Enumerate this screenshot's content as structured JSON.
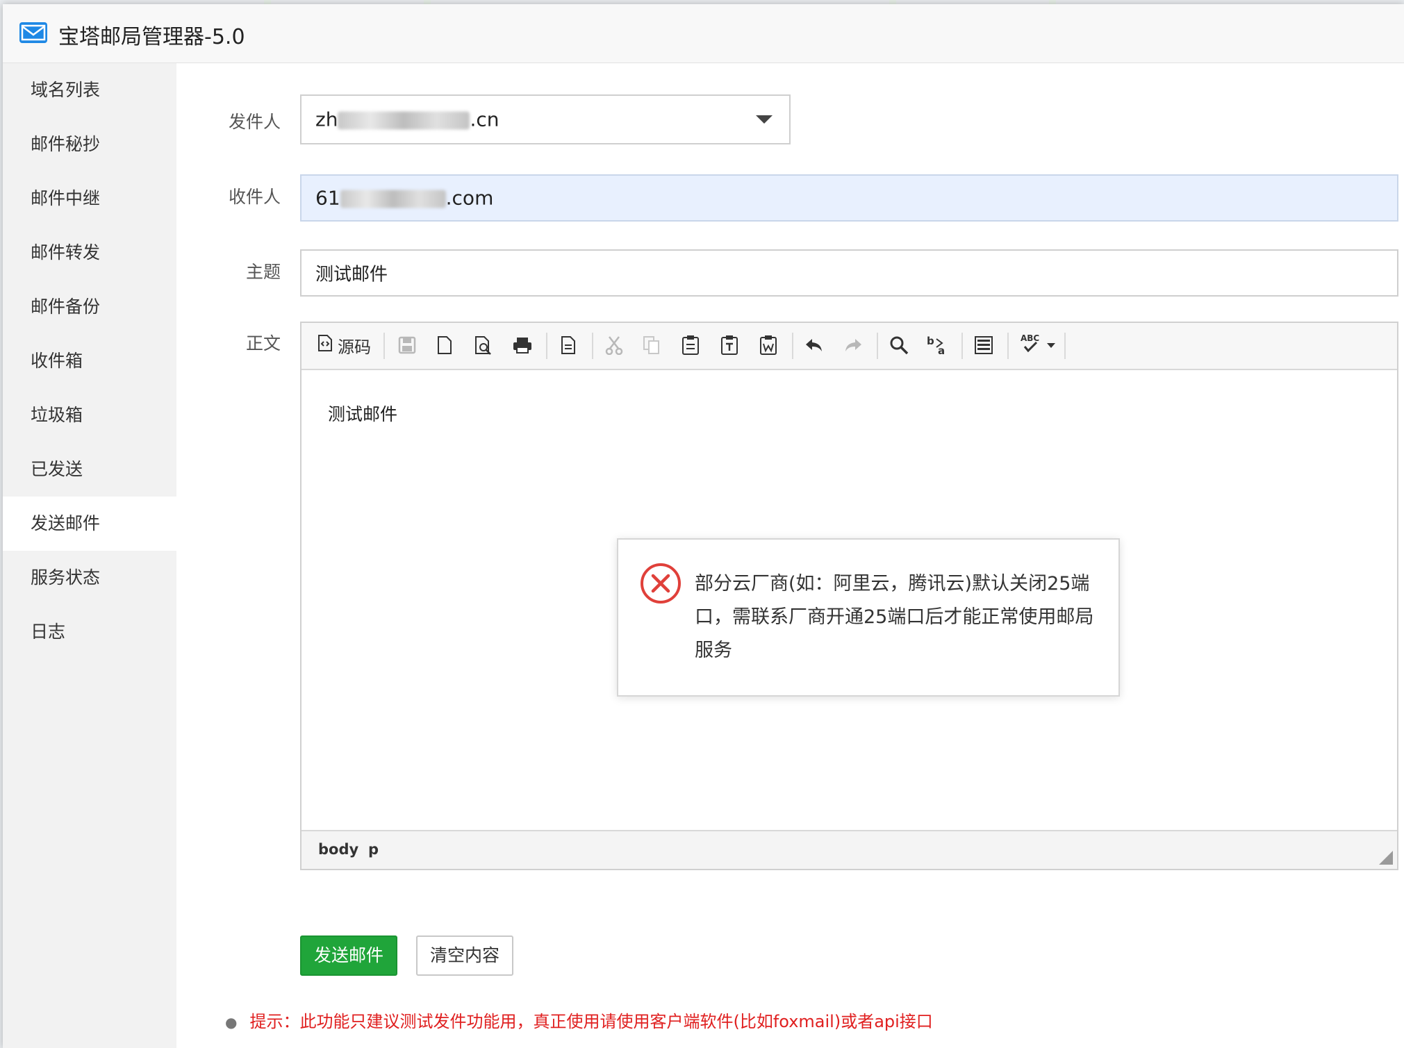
{
  "window": {
    "title": "宝塔邮局管理器-5.0",
    "icon": "mail-icon"
  },
  "sidebar": {
    "items": [
      {
        "label": "域名列表",
        "active": false
      },
      {
        "label": "邮件秘抄",
        "active": false
      },
      {
        "label": "邮件中继",
        "active": false
      },
      {
        "label": "邮件转发",
        "active": false
      },
      {
        "label": "邮件备份",
        "active": false
      },
      {
        "label": "收件箱",
        "active": false
      },
      {
        "label": "垃圾箱",
        "active": false
      },
      {
        "label": "已发送",
        "active": false
      },
      {
        "label": "发送邮件",
        "active": true
      },
      {
        "label": "服务状态",
        "active": false
      },
      {
        "label": "日志",
        "active": false
      }
    ]
  },
  "form": {
    "sender": {
      "label": "发件人",
      "value_prefix": "zh",
      "value_suffix": ".cn"
    },
    "recipient": {
      "label": "收件人",
      "value_prefix": "61",
      "value_suffix": ".com"
    },
    "subject": {
      "label": "主题",
      "value": "测试邮件"
    },
    "body": {
      "label": "正文",
      "content": "测试邮件"
    }
  },
  "editor": {
    "source_label": "源码",
    "path": [
      "body",
      "p"
    ],
    "toolbar_icons": [
      "source-icon",
      "save-icon",
      "new-page-icon",
      "preview-icon",
      "print-icon",
      "templates-icon",
      "cut-icon",
      "copy-icon",
      "paste-icon",
      "paste-text-icon",
      "paste-word-icon",
      "undo-icon",
      "redo-icon",
      "find-icon",
      "replace-icon",
      "select-all-icon",
      "spellcheck-icon"
    ]
  },
  "buttons": {
    "send": "发送邮件",
    "clear": "清空内容"
  },
  "tip": "提示：此功能只建议测试发件功能用，真正使用请使用客户端软件(比如foxmail)或者api接口",
  "alert": {
    "message": "部分云厂商(如：阿里云，腾讯云)默认关闭25端口，需联系厂商开通25端口后才能正常使用邮局服务",
    "icon": "error-circle-icon"
  },
  "colors": {
    "primary": "#20a53a",
    "tip": "#e02020",
    "error_icon": "#e0403a",
    "recipient_bg": "#e8f0fe"
  }
}
